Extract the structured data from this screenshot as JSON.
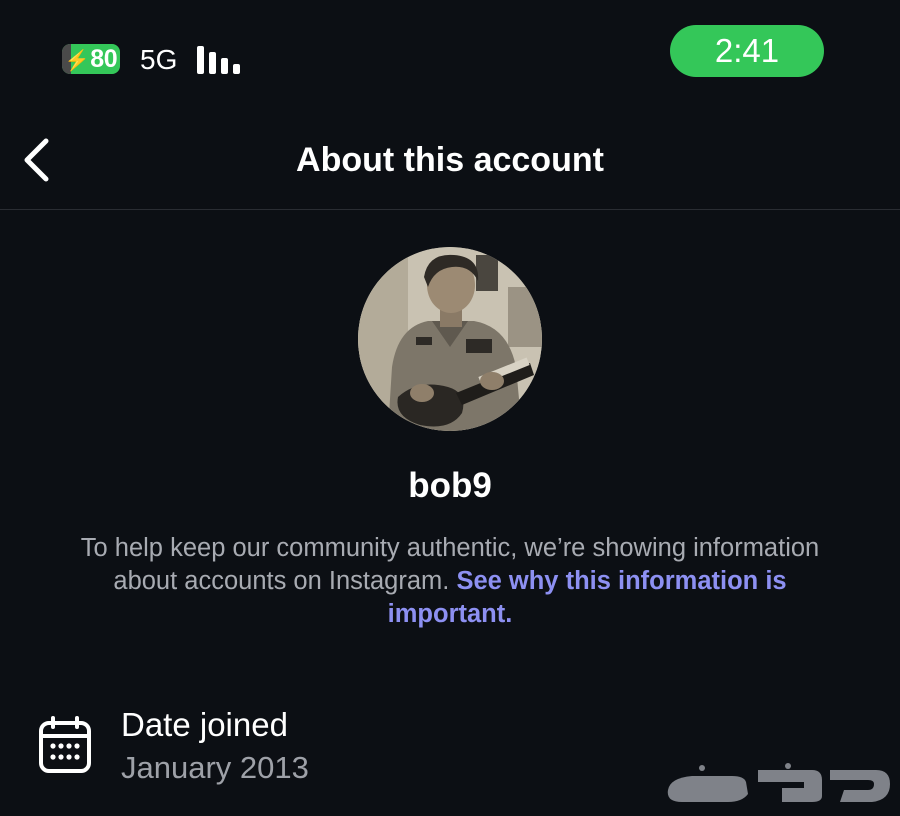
{
  "status_bar": {
    "battery_level": "80",
    "network": "5G",
    "time": "2:41"
  },
  "header": {
    "title": "About this account",
    "back_icon": "chevron-left-icon"
  },
  "profile": {
    "username": "bob9",
    "avatar_description_icon": "profile-photo"
  },
  "info": {
    "text": "To help keep our community authentic, we’re showing information about accounts on Instagram. ",
    "link_text": "See why this information is important."
  },
  "details": {
    "date_joined": {
      "icon": "calendar-icon",
      "label": "Date joined",
      "value": "January 2013"
    }
  },
  "colors": {
    "background": "#0c0f14",
    "accent_green": "#34c759",
    "link": "#8d90f2",
    "secondary_text": "#a8abb2"
  }
}
